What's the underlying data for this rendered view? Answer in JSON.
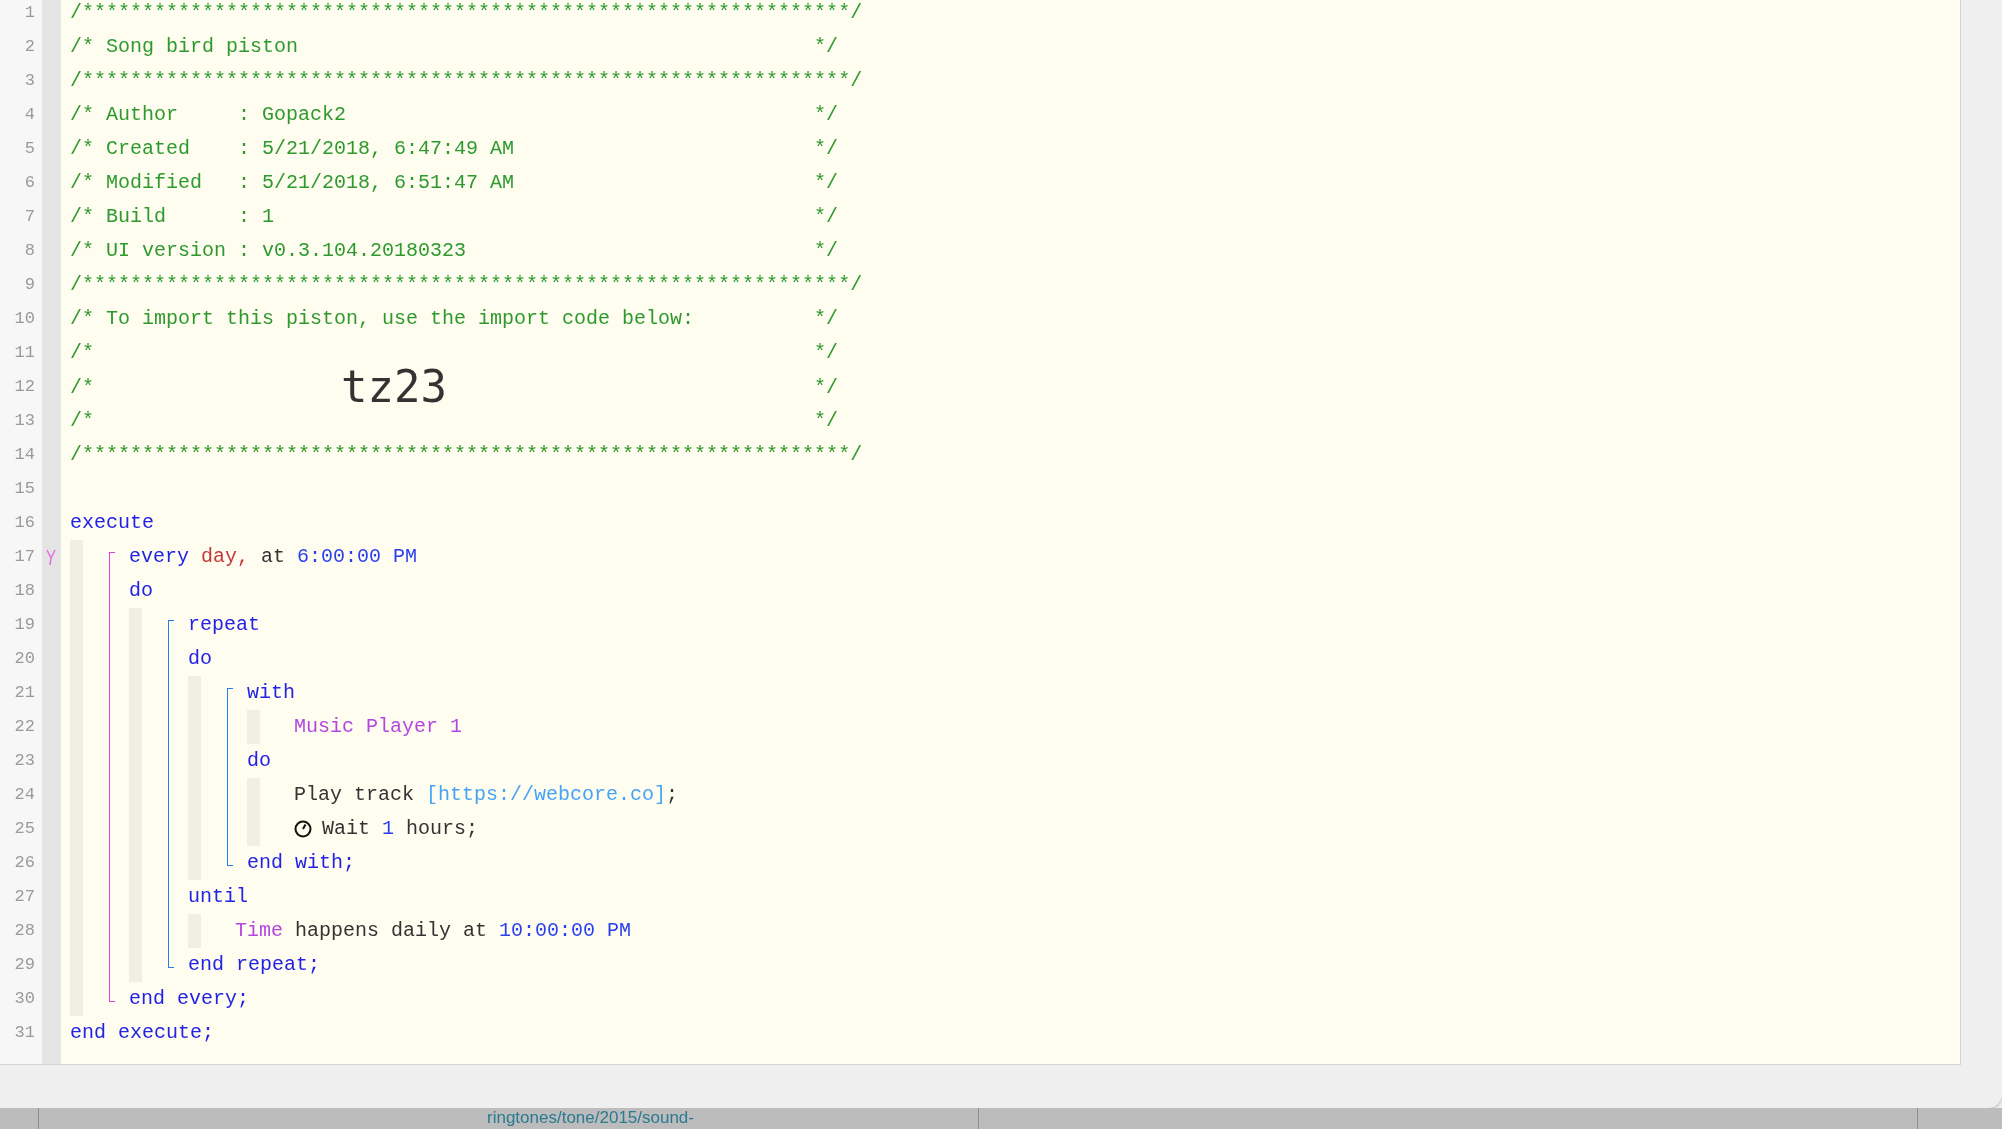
{
  "gutter": [
    {
      "number": "1",
      "flag": false
    },
    {
      "number": "2",
      "flag": false
    },
    {
      "number": "3",
      "flag": false
    },
    {
      "number": "4",
      "flag": false
    },
    {
      "number": "5",
      "flag": false
    },
    {
      "number": "6",
      "flag": false
    },
    {
      "number": "7",
      "flag": false
    },
    {
      "number": "8",
      "flag": false
    },
    {
      "number": "9",
      "flag": false
    },
    {
      "number": "10",
      "flag": false
    },
    {
      "number": "11",
      "flag": false
    },
    {
      "number": "12",
      "flag": false
    },
    {
      "number": "13",
      "flag": false
    },
    {
      "number": "14",
      "flag": false
    },
    {
      "number": "15",
      "flag": false
    },
    {
      "number": "16",
      "flag": false
    },
    {
      "number": "17",
      "flag": true
    },
    {
      "number": "18",
      "flag": false
    },
    {
      "number": "19",
      "flag": false
    },
    {
      "number": "20",
      "flag": false
    },
    {
      "number": "21",
      "flag": false
    },
    {
      "number": "22",
      "flag": false
    },
    {
      "number": "23",
      "flag": false
    },
    {
      "number": "24",
      "flag": false
    },
    {
      "number": "25",
      "flag": false
    },
    {
      "number": "26",
      "flag": false
    },
    {
      "number": "27",
      "flag": false
    },
    {
      "number": "28",
      "flag": false
    },
    {
      "number": "29",
      "flag": false
    },
    {
      "number": "30",
      "flag": false
    },
    {
      "number": "31",
      "flag": false
    }
  ],
  "code": [
    {
      "kind": "comment",
      "text": "/****************************************************************/"
    },
    {
      "kind": "comment",
      "text": "/* Song bird piston",
      "end": "*/"
    },
    {
      "kind": "comment",
      "text": "/****************************************************************/"
    },
    {
      "kind": "comment",
      "text": "/* Author     : Gopack2",
      "end": "*/"
    },
    {
      "kind": "comment",
      "text": "/* Created    : 5/21/2018, 6:47:49 AM",
      "end": "*/"
    },
    {
      "kind": "comment",
      "text": "/* Modified   : 5/21/2018, 6:51:47 AM",
      "end": "*/"
    },
    {
      "kind": "comment",
      "text": "/* Build      : 1",
      "end": "*/"
    },
    {
      "kind": "comment",
      "text": "/* UI version : v0.3.104.20180323",
      "end": "*/"
    },
    {
      "kind": "comment",
      "text": "/****************************************************************/"
    },
    {
      "kind": "comment",
      "text": "/* To import this piston, use the import code below:",
      "end": "*/"
    },
    {
      "kind": "comment",
      "text": "/*",
      "end": "*/"
    },
    {
      "kind": "import_code",
      "start": "/*",
      "code": "tz23",
      "end": "*/"
    },
    {
      "kind": "comment",
      "text": "/*",
      "end": "*/"
    },
    {
      "kind": "comment",
      "text": "/****************************************************************/"
    },
    {
      "kind": "blank"
    },
    {
      "kind": "block",
      "sections": [
        {
          "kind": "line",
          "tokens": [
            {
              "kind": "keyword",
              "text": "execute"
            }
          ]
        },
        {
          "kind": "body",
          "items": [
            {
              "kind": "block",
              "color": "#e040e0",
              "sections": [
                {
                  "kind": "line",
                  "tokens": [
                    {
                      "kind": "keyword",
                      "text": "every "
                    },
                    {
                      "kind": "attribute",
                      "text": "day,"
                    },
                    {
                      "kind": "plain",
                      "text": " at "
                    },
                    {
                      "kind": "number",
                      "text": "6:00:00 PM"
                    }
                  ]
                },
                {
                  "kind": "line",
                  "tokens": [
                    {
                      "kind": "keyword",
                      "text": "do"
                    }
                  ]
                },
                {
                  "kind": "body",
                  "items": [
                    {
                      "kind": "block",
                      "color": "#2080f0",
                      "sections": [
                        {
                          "kind": "line",
                          "tokens": [
                            {
                              "kind": "keyword",
                              "text": "repeat"
                            }
                          ]
                        },
                        {
                          "kind": "line",
                          "tokens": [
                            {
                              "kind": "keyword",
                              "text": "do"
                            }
                          ]
                        },
                        {
                          "kind": "body",
                          "items": [
                            {
                              "kind": "block",
                              "color": "#2080f0",
                              "sections": [
                                {
                                  "kind": "line",
                                  "tokens": [
                                    {
                                      "kind": "keyword",
                                      "text": "with"
                                    }
                                  ]
                                },
                                {
                                  "kind": "body",
                                  "items": [
                                    {
                                      "kind": "line",
                                      "tokens": [
                                        {
                                          "kind": "device",
                                          "text": "Music Player 1"
                                        }
                                      ]
                                    }
                                  ]
                                },
                                {
                                  "kind": "line",
                                  "tokens": [
                                    {
                                      "kind": "keyword",
                                      "text": "do"
                                    }
                                  ]
                                },
                                {
                                  "kind": "body",
                                  "items": [
                                    {
                                      "kind": "line",
                                      "tokens": [
                                        {
                                          "kind": "plain",
                                          "text": "Play track "
                                        },
                                        {
                                          "kind": "url",
                                          "text": "[https://webcore.co]"
                                        },
                                        {
                                          "kind": "plain",
                                          "text": ";"
                                        }
                                      ]
                                    },
                                    {
                                      "kind": "line",
                                      "tokens": [
                                        {
                                          "kind": "clock"
                                        },
                                        {
                                          "kind": "plain",
                                          "text": "Wait "
                                        },
                                        {
                                          "kind": "number",
                                          "text": "1"
                                        },
                                        {
                                          "kind": "plain",
                                          "text": " hours;"
                                        }
                                      ]
                                    }
                                  ]
                                },
                                {
                                  "kind": "line",
                                  "tokens": [
                                    {
                                      "kind": "keyword",
                                      "text": "end with;"
                                    }
                                  ]
                                }
                              ]
                            }
                          ]
                        },
                        {
                          "kind": "line",
                          "tokens": [
                            {
                              "kind": "keyword",
                              "text": "until"
                            }
                          ]
                        },
                        {
                          "kind": "body",
                          "items": [
                            {
                              "kind": "line",
                              "tokens": [
                                {
                                  "kind": "device",
                                  "text": "Time"
                                },
                                {
                                  "kind": "plain",
                                  "text": " happens daily at "
                                },
                                {
                                  "kind": "number",
                                  "text": "10:00:00 PM"
                                }
                              ]
                            }
                          ]
                        },
                        {
                          "kind": "line",
                          "tokens": [
                            {
                              "kind": "keyword",
                              "text": "end repeat;"
                            }
                          ]
                        }
                      ]
                    }
                  ]
                },
                {
                  "kind": "line",
                  "tokens": [
                    {
                      "kind": "keyword",
                      "text": "end every;"
                    }
                  ]
                }
              ]
            }
          ]
        },
        {
          "kind": "line",
          "tokens": [
            {
              "kind": "keyword",
              "text": "end execute;"
            }
          ]
        }
      ]
    }
  ],
  "status_text": "ringtones/tone/2015/sound-"
}
